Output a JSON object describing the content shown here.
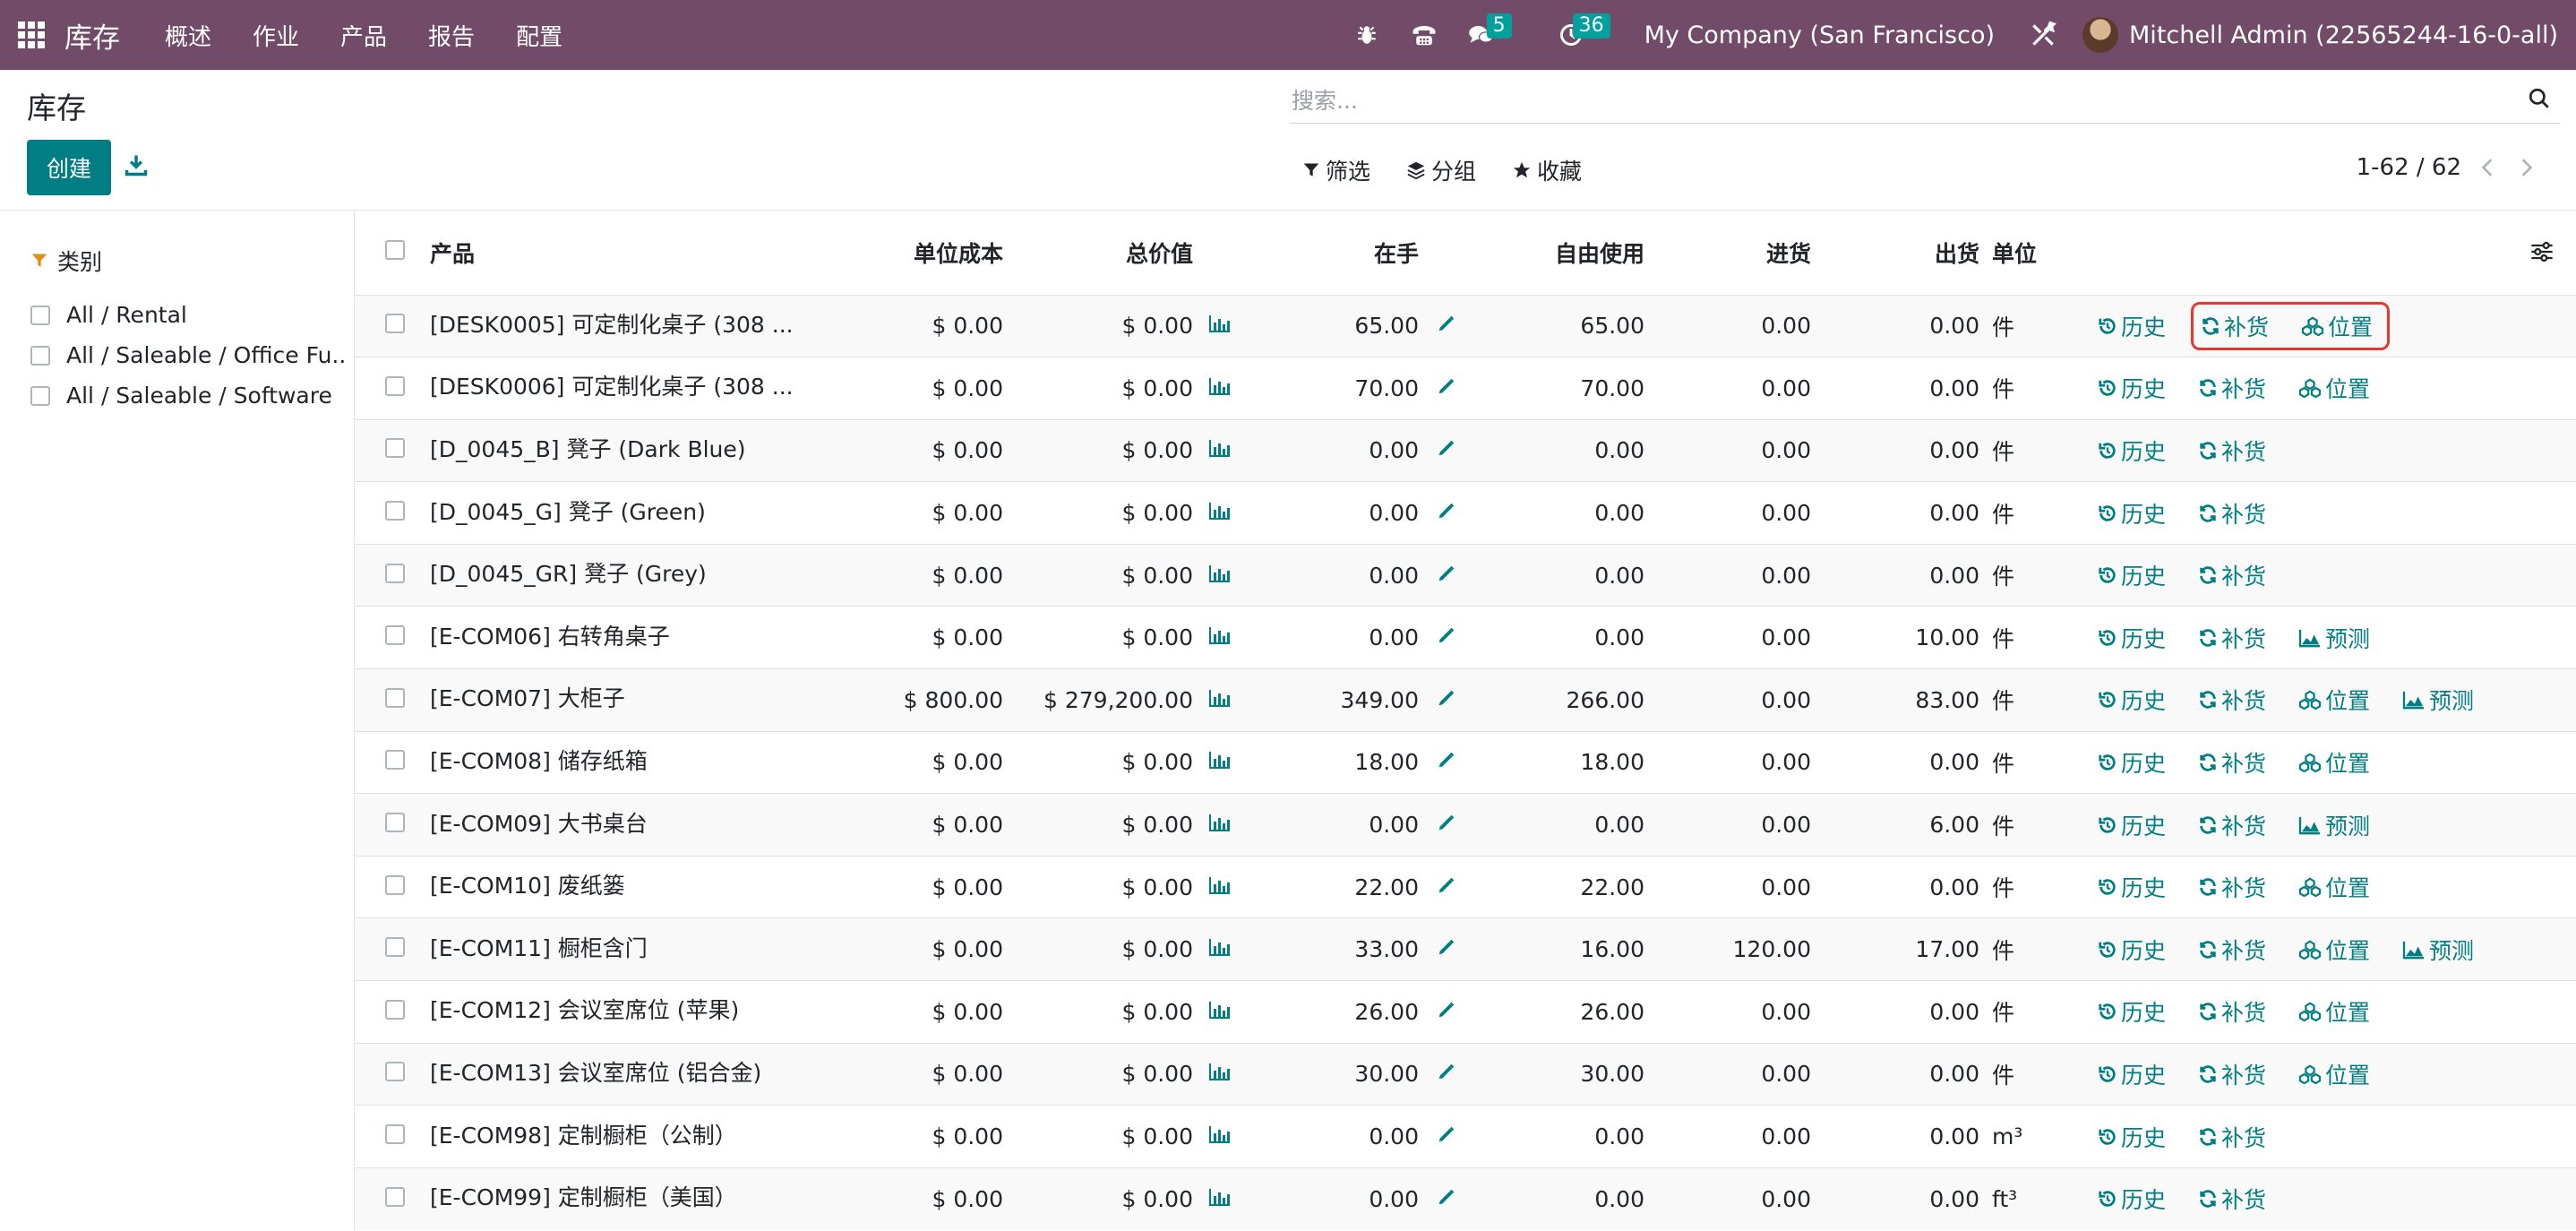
{
  "navbar": {
    "brand": "库存",
    "menu": [
      "概述",
      "作业",
      "产品",
      "报告",
      "配置"
    ],
    "messages_count": "5",
    "activities_count": "36",
    "company": "My Company (San Francisco)",
    "user": "Mitchell Admin (22565244-16-0-all)"
  },
  "control": {
    "title": "库存",
    "create_label": "创建",
    "search_placeholder": "搜索...",
    "filter_label": "筛选",
    "group_label": "分组",
    "favorite_label": "收藏",
    "pager": "1-62 / 62"
  },
  "sidebar": {
    "title": "类别",
    "items": [
      "All / Rental",
      "All / Saleable / Office Fu...",
      "All / Saleable / Software"
    ]
  },
  "table": {
    "headers": {
      "product": "产品",
      "unit_cost": "单位成本",
      "total_value": "总价值",
      "on_hand": "在手",
      "free_qty": "自由使用",
      "incoming": "进货",
      "outgoing": "出货",
      "uom": "单位"
    },
    "action_labels": {
      "history": "历史",
      "replenish": "补货",
      "locations": "位置",
      "forecast": "预测"
    },
    "rows": [
      {
        "product": "[DESK0005] 可定制化桌子 (308 ...",
        "cost": "$ 0.00",
        "total": "$ 0.00",
        "onhand": "65.00",
        "free": "65.00",
        "incoming": "0.00",
        "outgoing": "0.00",
        "uom": "件",
        "actions": [
          "history",
          "replenish",
          "locations"
        ],
        "highlight": true
      },
      {
        "product": "[DESK0006] 可定制化桌子 (308 ...",
        "cost": "$ 0.00",
        "total": "$ 0.00",
        "onhand": "70.00",
        "free": "70.00",
        "incoming": "0.00",
        "outgoing": "0.00",
        "uom": "件",
        "actions": [
          "history",
          "replenish",
          "locations"
        ]
      },
      {
        "product": "[D_0045_B] 凳子 (Dark Blue)",
        "cost": "$ 0.00",
        "total": "$ 0.00",
        "onhand": "0.00",
        "free": "0.00",
        "incoming": "0.00",
        "outgoing": "0.00",
        "uom": "件",
        "actions": [
          "history",
          "replenish"
        ]
      },
      {
        "product": "[D_0045_G] 凳子 (Green)",
        "cost": "$ 0.00",
        "total": "$ 0.00",
        "onhand": "0.00",
        "free": "0.00",
        "incoming": "0.00",
        "outgoing": "0.00",
        "uom": "件",
        "actions": [
          "history",
          "replenish"
        ]
      },
      {
        "product": "[D_0045_GR] 凳子 (Grey)",
        "cost": "$ 0.00",
        "total": "$ 0.00",
        "onhand": "0.00",
        "free": "0.00",
        "incoming": "0.00",
        "outgoing": "0.00",
        "uom": "件",
        "actions": [
          "history",
          "replenish"
        ]
      },
      {
        "product": "[E-COM06] 右转角桌子",
        "cost": "$ 0.00",
        "total": "$ 0.00",
        "onhand": "0.00",
        "free": "0.00",
        "incoming": "0.00",
        "outgoing": "10.00",
        "uom": "件",
        "actions": [
          "history",
          "replenish",
          "forecast"
        ]
      },
      {
        "product": "[E-COM07] 大柜子",
        "cost": "$ 800.00",
        "total": "$ 279,200.00",
        "onhand": "349.00",
        "free": "266.00",
        "incoming": "0.00",
        "outgoing": "83.00",
        "uom": "件",
        "actions": [
          "history",
          "replenish",
          "locations",
          "forecast"
        ]
      },
      {
        "product": "[E-COM08] 储存纸箱",
        "cost": "$ 0.00",
        "total": "$ 0.00",
        "onhand": "18.00",
        "free": "18.00",
        "incoming": "0.00",
        "outgoing": "0.00",
        "uom": "件",
        "actions": [
          "history",
          "replenish",
          "locations"
        ]
      },
      {
        "product": "[E-COM09] 大书桌台",
        "cost": "$ 0.00",
        "total": "$ 0.00",
        "onhand": "0.00",
        "free": "0.00",
        "incoming": "0.00",
        "outgoing": "6.00",
        "uom": "件",
        "actions": [
          "history",
          "replenish",
          "forecast"
        ]
      },
      {
        "product": "[E-COM10] 废纸篓",
        "cost": "$ 0.00",
        "total": "$ 0.00",
        "onhand": "22.00",
        "free": "22.00",
        "incoming": "0.00",
        "outgoing": "0.00",
        "uom": "件",
        "actions": [
          "history",
          "replenish",
          "locations"
        ]
      },
      {
        "product": "[E-COM11] 橱柜含门",
        "cost": "$ 0.00",
        "total": "$ 0.00",
        "onhand": "33.00",
        "free": "16.00",
        "incoming": "120.00",
        "outgoing": "17.00",
        "uom": "件",
        "actions": [
          "history",
          "replenish",
          "locations",
          "forecast"
        ]
      },
      {
        "product": "[E-COM12] 会议室席位 (苹果)",
        "cost": "$ 0.00",
        "total": "$ 0.00",
        "onhand": "26.00",
        "free": "26.00",
        "incoming": "0.00",
        "outgoing": "0.00",
        "uom": "件",
        "actions": [
          "history",
          "replenish",
          "locations"
        ]
      },
      {
        "product": "[E-COM13] 会议室席位 (铝合金)",
        "cost": "$ 0.00",
        "total": "$ 0.00",
        "onhand": "30.00",
        "free": "30.00",
        "incoming": "0.00",
        "outgoing": "0.00",
        "uom": "件",
        "actions": [
          "history",
          "replenish",
          "locations"
        ]
      },
      {
        "product": "[E-COM98] 定制橱柜（公制）",
        "cost": "$ 0.00",
        "total": "$ 0.00",
        "onhand": "0.00",
        "free": "0.00",
        "incoming": "0.00",
        "outgoing": "0.00",
        "uom": "m³",
        "actions": [
          "history",
          "replenish"
        ]
      },
      {
        "product": "[E-COM99] 定制橱柜（美国）",
        "cost": "$ 0.00",
        "total": "$ 0.00",
        "onhand": "0.00",
        "free": "0.00",
        "incoming": "0.00",
        "outgoing": "0.00",
        "uom": "ft³",
        "actions": [
          "history",
          "replenish"
        ]
      }
    ]
  },
  "colors": {
    "navbar": "#714b67",
    "primary": "#017e84",
    "highlight_box": "#e6382e",
    "badge": "#00a09d"
  }
}
